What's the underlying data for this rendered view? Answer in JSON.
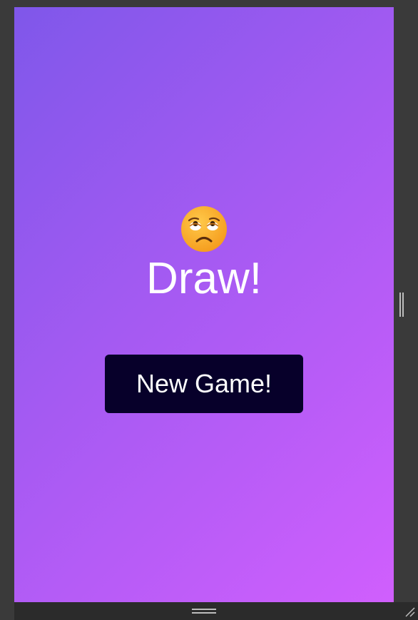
{
  "game": {
    "result_emoji_name": "face-with-rolling-eyes-icon",
    "result_text": "Draw!",
    "new_game_label": "New Game!"
  },
  "colors": {
    "gradient_start": "#7f57ea",
    "gradient_end": "#d05ffd",
    "button_bg": "#07002a",
    "text": "#ffffff",
    "emoji_face": "#f9a825"
  }
}
